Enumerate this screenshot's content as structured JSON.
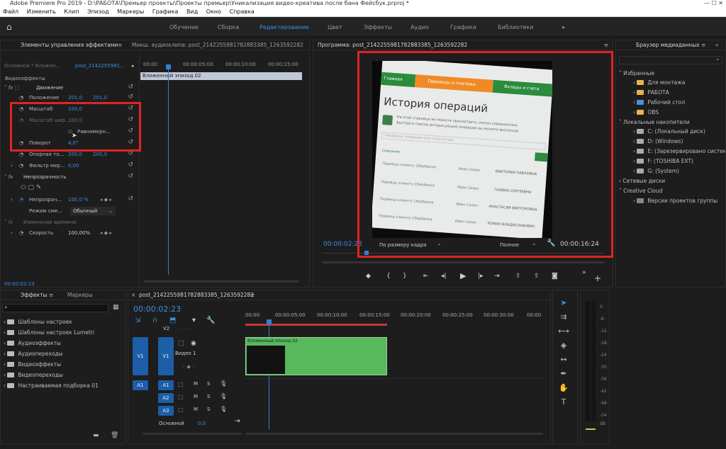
{
  "window": {
    "title": "Adobe Premiere Pro 2019 - D:\\РАБОТА\\Премьер проекты\\Проекты премьер\\Уникализация видео-креатива после бана Фейсбук.prproj *"
  },
  "menu": [
    "Файл",
    "Изменить",
    "Клип",
    "Эпизод",
    "Маркеры",
    "Графика",
    "Вид",
    "Окно",
    "Справка"
  ],
  "workspaces": {
    "items": [
      "Обучение",
      "Сборка",
      "Редактирование",
      "Цвет",
      "Эффекты",
      "Аудио",
      "Графика",
      "Библиотеки"
    ],
    "active_index": 2,
    "more": "»"
  },
  "effect_controls": {
    "tab_label": "Элементы управления эффектами",
    "tab_mixer": "Микш. аудиоклипа: post_2142255981782883385_1263592282",
    "master_label": "Основной * Вложен...",
    "clip_label": "post_2142255981...",
    "ruler": [
      "00:00",
      "00:00:05:00",
      "00:00:10:00",
      "00:00:15:00"
    ],
    "nested_clip": "Вложенный эпизод 02",
    "section_video": "Видеоэффекты",
    "motion": "Движение",
    "position_label": "Положение",
    "position_x": "201,0",
    "position_y": "201,0",
    "scale_label": "Масштаб",
    "scale_value": "100,0",
    "scale_width_label": "Масштаб шир...",
    "scale_width_value": "100,0",
    "uniform_label": "Равномерн...",
    "rotation_label": "Поворот",
    "rotation_value": "4,0°",
    "anchor_label": "Опорная то...",
    "anchor_x": "200,0",
    "anchor_y": "200,0",
    "flicker_label": "Фильтр мер...",
    "flicker_value": "0,00",
    "opacity": "Непрозрачность",
    "opacity_label": "Непрозрач...",
    "opacity_value": "100,0 %",
    "blend_label": "Режим сме...",
    "blend_value": "Обычный",
    "time_remap": "Изменение времени",
    "speed_label": "Скорость",
    "speed_value": "100,00%",
    "timecode": "00:00:02:23"
  },
  "program": {
    "tab_label": "Программа: post_2142255981782883385_1263592282",
    "timecode_current": "00:00:02:23",
    "fit_label": "По размеру кадра",
    "quality_label": "Полное",
    "duration": "00:00:16:24",
    "frame": {
      "tabs": [
        "Главная",
        "Переводы и платежи",
        "Вклады и счета"
      ],
      "heading": "История операций",
      "desc_line1": "На этой странице вы можете просмотреть список совершенных",
      "desc_line2": "Быстрого поиска интересующей операции вы можете воспользо",
      "search_hint": "Название, операция или получатель",
      "col_left": "Списания",
      "rows": [
        {
          "op": "Перевод клиенту Сбербанка",
          "who": "Иван Сизин",
          "name": "ВИКТОРИЯ ПАВЛОВНА"
        },
        {
          "op": "Перевод клиенту Сбербанка",
          "who": "Иван Сизин",
          "name": "ГАЛИНА СЕРГЕЕВНА"
        },
        {
          "op": "Перевод клиенту Сбербанка",
          "who": "Иван Сизин",
          "name": "АНАСТАСИЯ ВИКТОРОВНА"
        },
        {
          "op": "Перевод клиенту Сбербанка",
          "who": "Иван Сизин",
          "name": "РОМАН ВЛАДИСЛАВОВИЧ"
        }
      ]
    }
  },
  "media_browser": {
    "tab_label": "Браузер медиаданных",
    "sections": {
      "favorites": "Избранные",
      "local": "Локальные накопители",
      "network": "Сетевые диски",
      "cloud": "Creative Cloud"
    },
    "favorites": [
      "Для монтажа",
      "РАБОТА",
      "Рабочий стол",
      "OBS"
    ],
    "drives": [
      "C: (Локальный диск)",
      "D: (Windows)",
      "E: (Зарезервировано систем",
      "F: (TOSHIBA EXT)",
      "G: (System)"
    ],
    "cloud_item": "Версии проектов группы"
  },
  "effects_panel": {
    "tab_effects": "Эффекты",
    "tab_markers": "Маркеры",
    "items": [
      "Шаблоны настроек",
      "Шаблоны настроек Lumetri",
      "Аудиоэффекты",
      "Аудиопереходы",
      "Видеоэффекты",
      "Видеопереходы",
      "Настраиваемая подборка 01"
    ]
  },
  "timeline": {
    "tab_label": "post_2142255981782883385_1263592282",
    "timecode": "00:00:02:23",
    "ruler": [
      "00:00",
      "00:00:05:00",
      "00:00:10:00",
      "00:00:15:00",
      "00:00:20:00",
      "00:00:25:00",
      "00:00:30:00",
      "00:00"
    ],
    "tracks": {
      "v2": "V2",
      "v1_src": "V1",
      "v1": "V1",
      "video1_name": "Видео 1",
      "a1_src": "A1",
      "a1": "A1",
      "a2": "A2",
      "a3": "A3",
      "mute": "M",
      "solo": "S",
      "master": "Основной",
      "master_value": "0,0"
    },
    "clip_label": "Вложенный эпизод 02"
  },
  "meter": {
    "scale": [
      "0",
      "-6",
      "-12",
      "-18",
      "-24",
      "-30",
      "-36",
      "-42",
      "-48",
      "-54",
      "dB"
    ]
  }
}
